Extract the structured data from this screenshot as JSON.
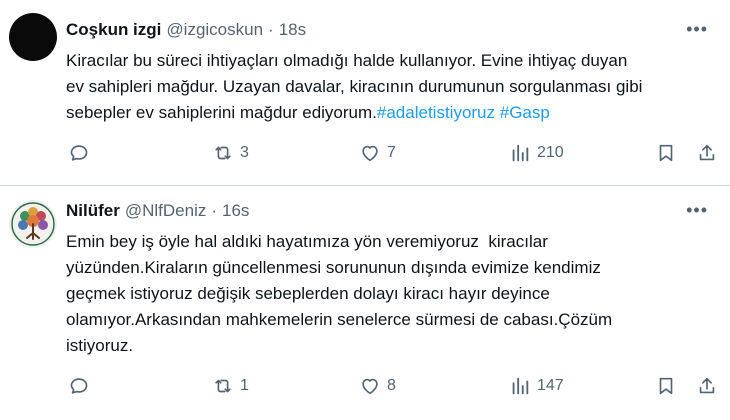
{
  "tweets": [
    {
      "author_name": "Coşkun izgi",
      "handle": "@izgicoskun",
      "separator": "·",
      "time": "18s",
      "text_lines": [
        "Kiracılar bu süreci ihtiyaçları olmadığı halde kullanıyor. Evine ihtiyaç duyan",
        "ev sahipleri mağdur. Uzayan davalar, kiracının durumunun sorgulanması gibi",
        "sebepler ev sahiplerini mağdur ediyorum."
      ],
      "hashtags": [
        "#adaletistiyoruz",
        "#Gasp"
      ],
      "avatar": "dark-circle-avatar",
      "replies": "",
      "retweets": "3",
      "likes": "7",
      "views": "210"
    },
    {
      "author_name": "Nilüfer",
      "handle": "@NlfDeniz",
      "separator": "·",
      "time": "16s",
      "text_lines": [
        "Emin bey iş öyle hal aldıki hayatımıza yön veremiyoruz  kiracılar",
        "yüzünden.Kiraların güncellenmesi sorununun dışında evimize kendimiz",
        "geçmek istiyoruz değişik sebeplerden dolayı kiracı hayır deyince",
        "olamıyor.Arkasından mahkemelerin senelerce sürmesi de cabası.Çözüm",
        "istiyoruz."
      ],
      "avatar": "tree-of-life-avatar",
      "replies": "",
      "retweets": "1",
      "likes": "8",
      "views": "147"
    }
  ],
  "icons": {
    "reply": "reply-icon",
    "retweet": "retweet-icon",
    "like": "heart-icon",
    "views": "views-icon",
    "bookmark": "bookmark-icon",
    "share": "share-icon",
    "more": "more-icon"
  },
  "colors": {
    "text": "#0f1419",
    "secondary": "#536471",
    "link": "#1d9bf0",
    "divider": "#cfd9de"
  }
}
